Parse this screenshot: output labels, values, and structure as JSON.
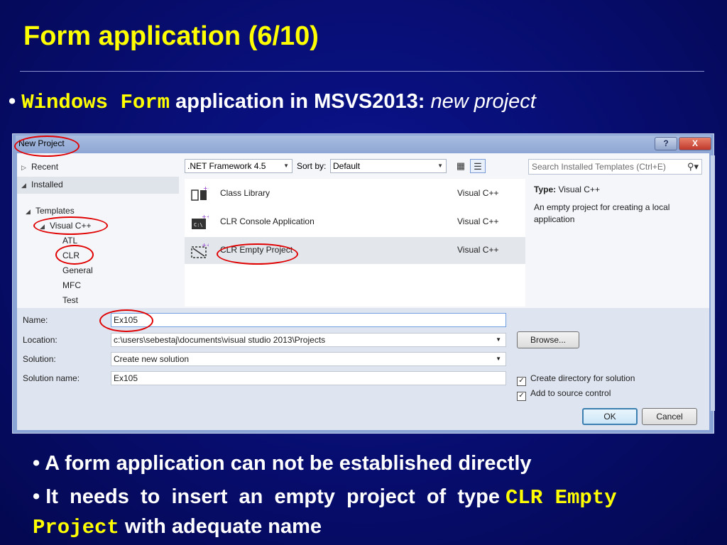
{
  "slide": {
    "title": "Form application (6/10)",
    "bullet1": {
      "marker": "•",
      "code": "Windows Form",
      "text": " application in MSVS2013: ",
      "italic": "new project"
    },
    "bullet2": {
      "marker": "•",
      "text": "A form application can not be established directly"
    },
    "bullet3": {
      "marker": "•",
      "text1": "It  needs  to  insert  an  empty  project  of  type ",
      "code1": "CLR Empty",
      "code2": "Project",
      "text2": " with adequate name"
    }
  },
  "dialog": {
    "title": "New Project",
    "help_label": "?",
    "close_label": "X",
    "tree": {
      "recent": "Recent",
      "installed": "Installed",
      "templates": "Templates",
      "visual_cpp": "Visual C++",
      "children": [
        "ATL",
        "CLR",
        "General",
        "MFC",
        "Test"
      ]
    },
    "toolbar": {
      "framework": ".NET Framework 4.5",
      "sort_label": "Sort by:",
      "sort_value": "Default"
    },
    "templates": [
      {
        "name": "Class Library",
        "lang": "Visual C++"
      },
      {
        "name": "CLR Console Application",
        "lang": "Visual C++"
      },
      {
        "name": "CLR Empty Project",
        "lang": "Visual C++"
      }
    ],
    "search_placeholder": "Search Installed Templates (Ctrl+E)",
    "details": {
      "type_label": "Type:",
      "type_value": "Visual C++",
      "description": "An empty project for creating a local application"
    },
    "form": {
      "name_label": "Name:",
      "name_value": "Ex105",
      "location_label": "Location:",
      "location_value": "c:\\users\\sebestaj\\documents\\visual studio 2013\\Projects",
      "solution_label": "Solution:",
      "solution_value": "Create new solution",
      "solution_name_label": "Solution name:",
      "solution_name_value": "Ex105",
      "browse_label": "Browse...",
      "create_dir_label": "Create directory for solution",
      "source_control_label": "Add to source control",
      "ok_label": "OK",
      "cancel_label": "Cancel"
    }
  }
}
